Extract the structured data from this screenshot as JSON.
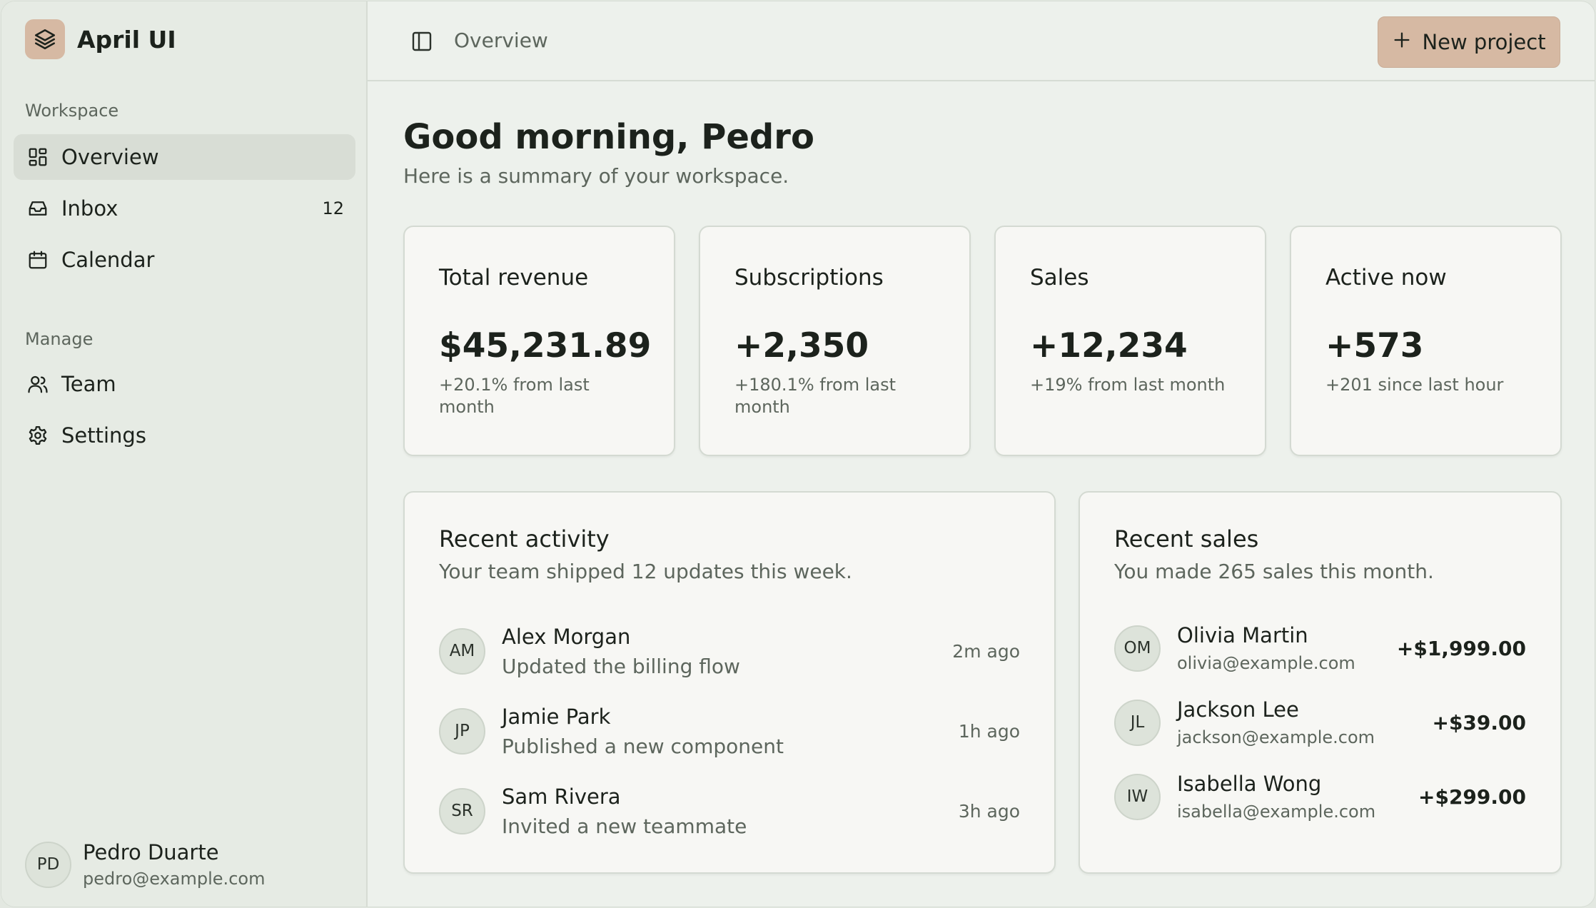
{
  "brand": {
    "name": "April UI"
  },
  "sidebar": {
    "workspace_label": "Workspace",
    "workspace_items": [
      {
        "label": "Overview",
        "icon": "dashboard-icon",
        "active": true
      },
      {
        "label": "Inbox",
        "icon": "inbox-icon",
        "count": "12"
      },
      {
        "label": "Calendar",
        "icon": "calendar-icon"
      }
    ],
    "manage_label": "Manage",
    "manage_items": [
      {
        "label": "Team",
        "icon": "users-icon"
      },
      {
        "label": "Settings",
        "icon": "gear-icon"
      }
    ],
    "user": {
      "initials": "PD",
      "name": "Pedro Duarte",
      "email": "pedro@example.com"
    }
  },
  "topbar": {
    "breadcrumb": "Overview",
    "new_project_label": "New project"
  },
  "page": {
    "greeting": "Good morning, Pedro",
    "subtitle": "Here is a summary of your workspace."
  },
  "stats": [
    {
      "title": "Total revenue",
      "value": "$45,231.89",
      "note": "+20.1% from last month"
    },
    {
      "title": "Subscriptions",
      "value": "+2,350",
      "note": "+180.1% from last month"
    },
    {
      "title": "Sales",
      "value": "+12,234",
      "note": "+19% from last month"
    },
    {
      "title": "Active now",
      "value": "+573",
      "note": "+201 since last hour"
    }
  ],
  "activity": {
    "title": "Recent activity",
    "subtitle": "Your team shipped 12 updates this week.",
    "items": [
      {
        "initials": "AM",
        "name": "Alex Morgan",
        "desc": "Updated the billing flow",
        "time": "2m ago"
      },
      {
        "initials": "JP",
        "name": "Jamie Park",
        "desc": "Published a new component",
        "time": "1h ago"
      },
      {
        "initials": "SR",
        "name": "Sam Rivera",
        "desc": "Invited a new teammate",
        "time": "3h ago"
      }
    ]
  },
  "sales": {
    "title": "Recent sales",
    "subtitle": "You made 265 sales this month.",
    "items": [
      {
        "initials": "OM",
        "name": "Olivia Martin",
        "email": "olivia@example.com",
        "amount": "+$1,999.00"
      },
      {
        "initials": "JL",
        "name": "Jackson Lee",
        "email": "jackson@example.com",
        "amount": "+$39.00"
      },
      {
        "initials": "IW",
        "name": "Isabella Wong",
        "email": "isabella@example.com",
        "amount": "+$299.00"
      }
    ]
  },
  "colors": {
    "accent": "#d6b9a3",
    "sidebar_bg": "#e6ebe4",
    "main_bg": "#edf1ec",
    "card_bg": "#f7f7f4"
  }
}
